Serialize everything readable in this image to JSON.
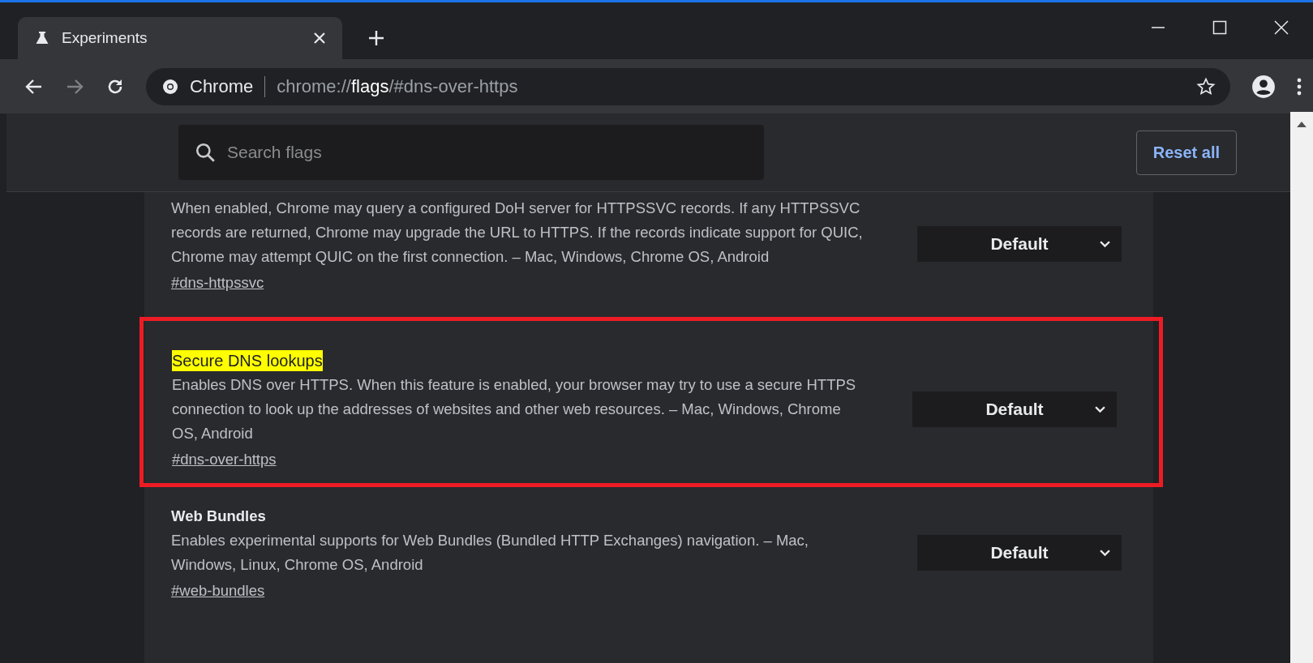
{
  "tab": {
    "title": "Experiments",
    "selected": true
  },
  "address_bar": {
    "site_label": "Chrome",
    "url_scheme": "chrome://",
    "url_host": "flags",
    "url_path": "/#dns-over-https"
  },
  "search": {
    "placeholder": "Search flags"
  },
  "reset_button": "Reset all",
  "flags": [
    {
      "annotated": false,
      "description": "When enabled, Chrome may query a configured DoH server for HTTPSSVC records. If any HTTPSSVC records are returned, Chrome may upgrade the URL to HTTPS. If the records indicate support for QUIC, Chrome may attempt QUIC on the first connection. – Mac, Windows, Chrome OS, Android",
      "link": "#dns-httpssvc",
      "value": "Default"
    },
    {
      "title": "Secure DNS lookups",
      "title_highlighted": true,
      "annotated": true,
      "description": "Enables DNS over HTTPS. When this feature is enabled, your browser may try to use a secure HTTPS connection to look up the addresses of websites and other web resources. – Mac, Windows, Chrome OS, Android",
      "link": "#dns-over-https",
      "value": "Default"
    },
    {
      "title": "Web Bundles",
      "title_highlighted": false,
      "annotated": false,
      "description": "Enables experimental supports for Web Bundles (Bundled HTTP Exchanges) navigation. – Mac, Windows, Linux, Chrome OS, Android",
      "link": "#web-bundles",
      "value": "Default"
    }
  ]
}
